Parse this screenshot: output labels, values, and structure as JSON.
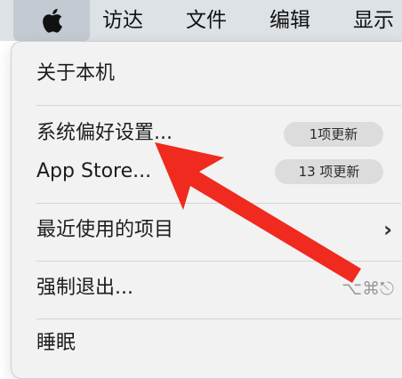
{
  "menubar": {
    "apple_icon": "apple-logo-icon",
    "items": [
      {
        "label": "访达"
      },
      {
        "label": "文件"
      },
      {
        "label": "编辑"
      },
      {
        "label": "显示"
      }
    ]
  },
  "menu": {
    "about": "关于本机",
    "system_prefs": "系统偏好设置...",
    "system_prefs_badge": "1项更新",
    "app_store": "App Store...",
    "app_store_badge": "13 项更新",
    "recent_items": "最近使用的项目",
    "recent_chevron": "›",
    "force_quit": "强制退出...",
    "force_quit_shortcut": "⌥⌘⎋",
    "sleep": "睡眠"
  },
  "colors": {
    "menubar_bg": "#dde2e7",
    "apple_tab_bg": "#c4cad1",
    "menu_bg": "#f2f2f2",
    "badge_bg": "#dcdcdc",
    "arrow": "#f02a1e"
  }
}
